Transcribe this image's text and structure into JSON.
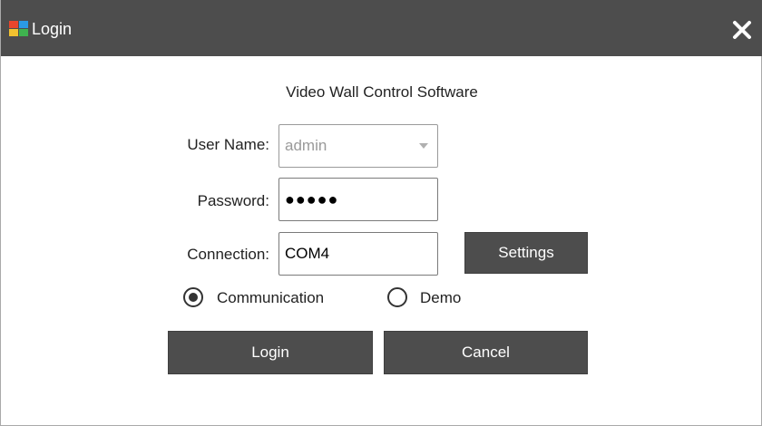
{
  "window": {
    "title": "Login",
    "close_icon": "close-icon",
    "app_icon": "app-logo-icon",
    "app_icon_colors": [
      "#e8452c",
      "#2b9ae3",
      "#f2c230",
      "#3fb34f"
    ]
  },
  "heading": "Video Wall Control Software",
  "form": {
    "username_label": "User Name:",
    "username_value": "admin",
    "password_label": "Password:",
    "password_masked": "●●●●●",
    "connection_label": "Connection:",
    "connection_value": "COM4",
    "settings_label": "Settings"
  },
  "mode": {
    "options": [
      {
        "label": "Communication",
        "selected": true
      },
      {
        "label": "Demo",
        "selected": false
      }
    ]
  },
  "actions": {
    "login_label": "Login",
    "cancel_label": "Cancel"
  },
  "colors": {
    "titlebar": "#4d4d4d",
    "button": "#4d4d4d",
    "background": "#ffffff"
  }
}
